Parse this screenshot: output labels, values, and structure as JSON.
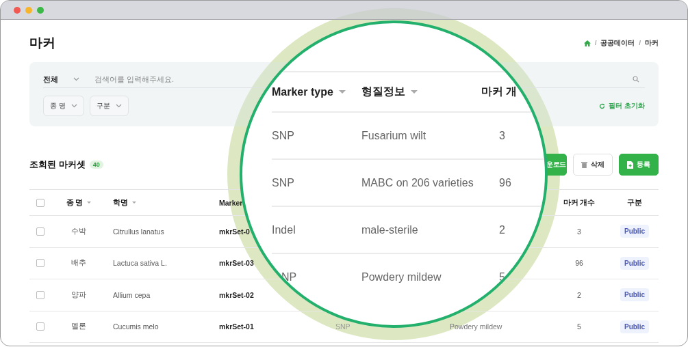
{
  "page": {
    "title": "마커",
    "separator": "/",
    "breadcrumb": [
      "공공데이터",
      "마커"
    ]
  },
  "filters": {
    "scope": "전체",
    "search": {
      "placeholder": "검색어를 입력해주세요."
    },
    "selects": [
      "종 명",
      "구분"
    ],
    "reset": "필터 초기화"
  },
  "results": {
    "title": "조회된 마커셋",
    "count": "40",
    "buttons": [
      {
        "label": "운로드",
        "kind": "download"
      },
      {
        "label": "삭제",
        "kind": "delete"
      },
      {
        "label": "등록",
        "kind": "register"
      }
    ]
  },
  "table": {
    "all_checked": false,
    "columns": {
      "species": {
        "label": "종 명",
        "sortable": true
      },
      "scientific_name": {
        "label": "학명",
        "sortable": true
      },
      "marker_set": {
        "label": "Marker"
      },
      "marker_count": {
        "label": "마커 개수"
      },
      "access": {
        "label": "구분"
      }
    },
    "rows": [
      {
        "checked": false,
        "species": "수박",
        "scientific_name": "Citrullus lanatus",
        "marker_set": "mkrSet-0",
        "marker_count": "3",
        "access": "Public"
      },
      {
        "checked": false,
        "species": "배추",
        "scientific_name": "Lactuca sativa L.",
        "marker_set": "mkrSet-03",
        "marker_count": "96",
        "access": "Public"
      },
      {
        "checked": false,
        "species": "양파",
        "scientific_name": "Allium cepa",
        "marker_set": "mkrSet-02",
        "marker_count": "2",
        "access": "Public"
      },
      {
        "checked": false,
        "species": "멜론",
        "scientific_name": "Cucumis melo",
        "marker_set": "mkrSet-01",
        "marker_type": "SNP",
        "trait": "Powdery mildew",
        "marker_count": "5",
        "access": "Public"
      }
    ]
  },
  "magnifier": {
    "columns": [
      {
        "label": "Marker type",
        "sortable": true
      },
      {
        "label": "형질정보",
        "sortable": true
      },
      {
        "label": "마커 개"
      }
    ],
    "rows": [
      {
        "marker_type": "SNP",
        "trait": "Fusarium wilt",
        "marker_count": "3"
      },
      {
        "marker_type": "SNP",
        "trait": "MABC on 206 varieties",
        "marker_count": "96"
      },
      {
        "marker_type": "Indel",
        "trait": "male-sterile",
        "marker_count": "2"
      },
      {
        "marker_type": "NP",
        "trait": "Powdery mildew",
        "marker_count": "5"
      }
    ]
  }
}
